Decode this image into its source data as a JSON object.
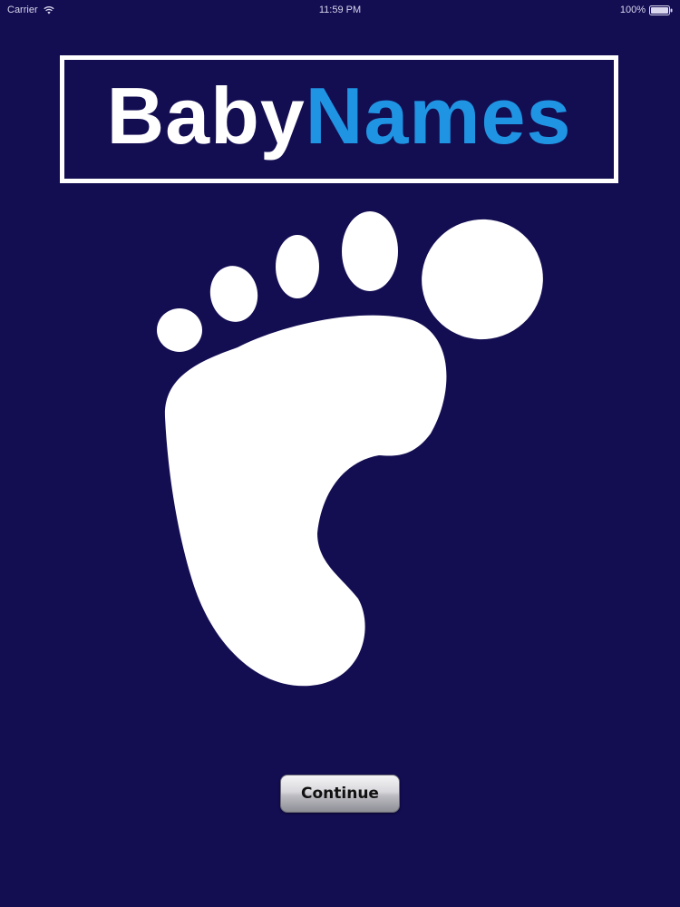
{
  "status_bar": {
    "carrier": "Carrier",
    "time": "11:59 PM",
    "battery": "100%",
    "wifi_icon": "wifi-icon",
    "battery_icon": "battery-icon"
  },
  "logo": {
    "part1": "Baby",
    "part2": "Names",
    "part1_color": "#ffffff",
    "part2_color": "#1f94e3"
  },
  "illustration": {
    "icon": "baby-footprint-icon"
  },
  "actions": {
    "continue_label": "Continue"
  },
  "colors": {
    "background": "#130d52",
    "accent": "#1f94e3"
  }
}
